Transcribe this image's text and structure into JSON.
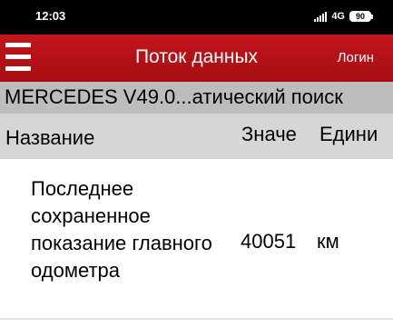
{
  "status_bar": {
    "time": "12:03",
    "network": "4G",
    "battery": "90"
  },
  "app_bar": {
    "menu_icon": "hamburger-menu-icon",
    "title": "Поток данных",
    "login": "Логин",
    "color": "#b31217"
  },
  "vehicle": {
    "label": "MERCEDES V49.0...атический поиск"
  },
  "table": {
    "headers": [
      "Название",
      "Значе",
      "Едини"
    ],
    "rows": [
      {
        "name": "Последнее сохраненное показание главного одометра",
        "value": "40051",
        "unit": "км"
      }
    ]
  }
}
